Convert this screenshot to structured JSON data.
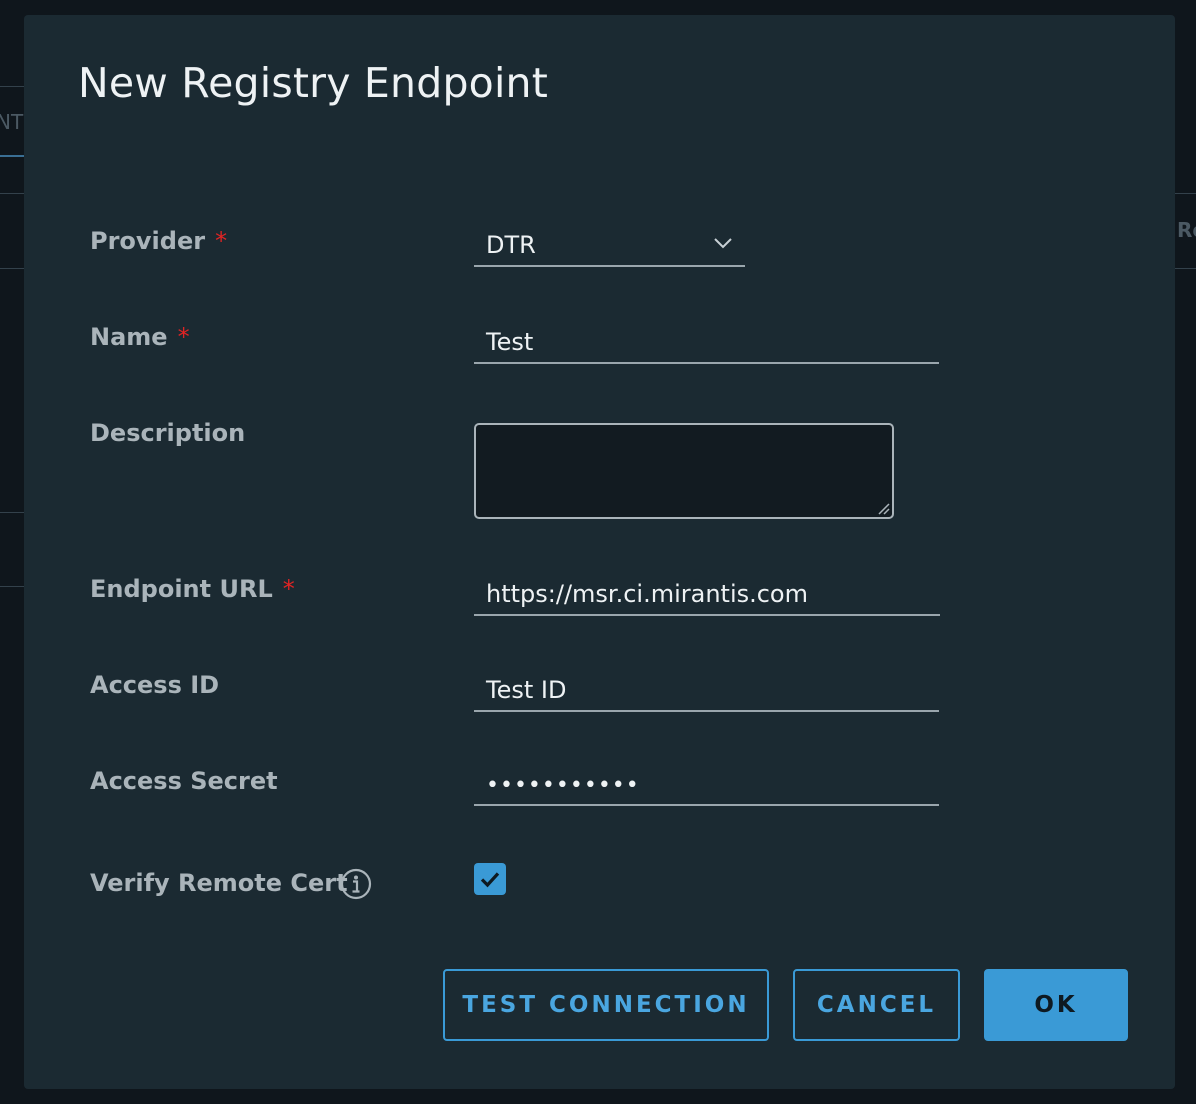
{
  "background": {
    "left_fragment": "NT",
    "right_fragment": "Re"
  },
  "dialog": {
    "title": "New Registry Endpoint",
    "required_marker": "*",
    "fields": {
      "provider": {
        "label": "Provider",
        "value": "DTR",
        "required": true
      },
      "name": {
        "label": "Name",
        "value": "Test",
        "required": true
      },
      "description": {
        "label": "Description",
        "value": ""
      },
      "endpoint_url": {
        "label": "Endpoint URL",
        "value": "https://msr.ci.mirantis.com",
        "required": true
      },
      "access_id": {
        "label": "Access ID",
        "value": "Test ID"
      },
      "access_secret": {
        "label": "Access Secret",
        "value": "•••••••••••"
      },
      "verify_remote_cert": {
        "label": "Verify Remote Cert",
        "checked": true
      }
    },
    "buttons": {
      "test_connection": "TEST CONNECTION",
      "cancel": "CANCEL",
      "ok": "OK"
    }
  },
  "colors": {
    "accent": "#3a9ad6",
    "dialog_bg": "#1b2a32",
    "required": "#e02424"
  },
  "icons": {
    "provider_dropdown": "chevron-down-icon",
    "verify_info": "info-icon",
    "checkbox": "checkmark-icon"
  }
}
